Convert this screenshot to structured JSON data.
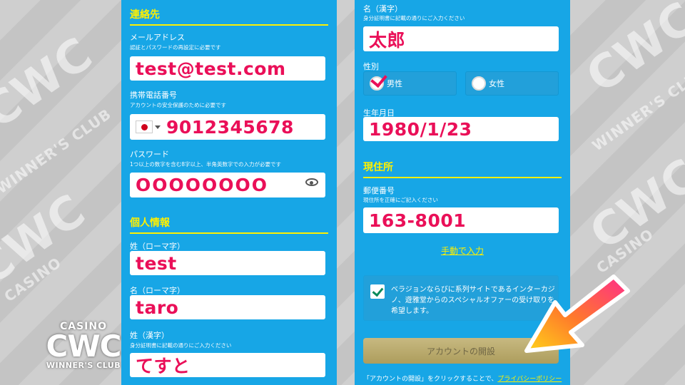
{
  "watermark": {
    "brand": "CWC",
    "tagline": "WINNER'S CLUB",
    "casino": "CASINO"
  },
  "left": {
    "contact_title": "連絡先",
    "email": {
      "label": "メールアドレス",
      "hint": "認証とパスワードの再設定に必要です",
      "value": "test@test.com"
    },
    "phone": {
      "label": "携帯電話番号",
      "hint": "アカウントの安全保護のために必要です",
      "value": "9012345678",
      "flag": "japan-flag-icon"
    },
    "password": {
      "label": "パスワード",
      "hint": "1つ以上の数字を含む8字以上、半角英数字での入力が必要です",
      "value": "OOOOOOOO"
    },
    "personal_title": "個人情報",
    "last_name_roman": {
      "label": "姓（ローマ字）",
      "value": "test"
    },
    "first_name_roman": {
      "label": "名（ローマ字）",
      "value": "taro"
    },
    "last_name_kanji": {
      "label": "姓（漢字）",
      "hint": "身分証明書に記載の通りにご入力ください",
      "value": "てすと"
    }
  },
  "right": {
    "first_name_kanji": {
      "label": "名（漢字）",
      "hint": "身分証明書に記載の通りにご入力ください",
      "value": "太郎"
    },
    "gender": {
      "label": "性別",
      "male": "男性",
      "female": "女性",
      "selected": "男性"
    },
    "birthdate": {
      "label": "生年月日",
      "value": "1980/1/23"
    },
    "address_title": "現住所",
    "postal": {
      "label": "郵便番号",
      "hint": "現住所を正確にご記入ください",
      "value": "163-8001"
    },
    "manual_link": "手動で入力",
    "consent": {
      "text": "ベラジョンならびに系列サイトであるインターカジノ、遊雅堂からのスペシャルオファーの受け取りを希望します。",
      "checked": true
    },
    "open_button": "アカウントの開設",
    "footer": {
      "prefix": "「アカウントの開設」をクリックすることで、",
      "link": "プライバシーポリシー"
    }
  },
  "colors": {
    "panel": "#17a6e6",
    "accent_yellow": "#fff000",
    "input_text": "#ea0f58",
    "button": "#b8a96b"
  }
}
